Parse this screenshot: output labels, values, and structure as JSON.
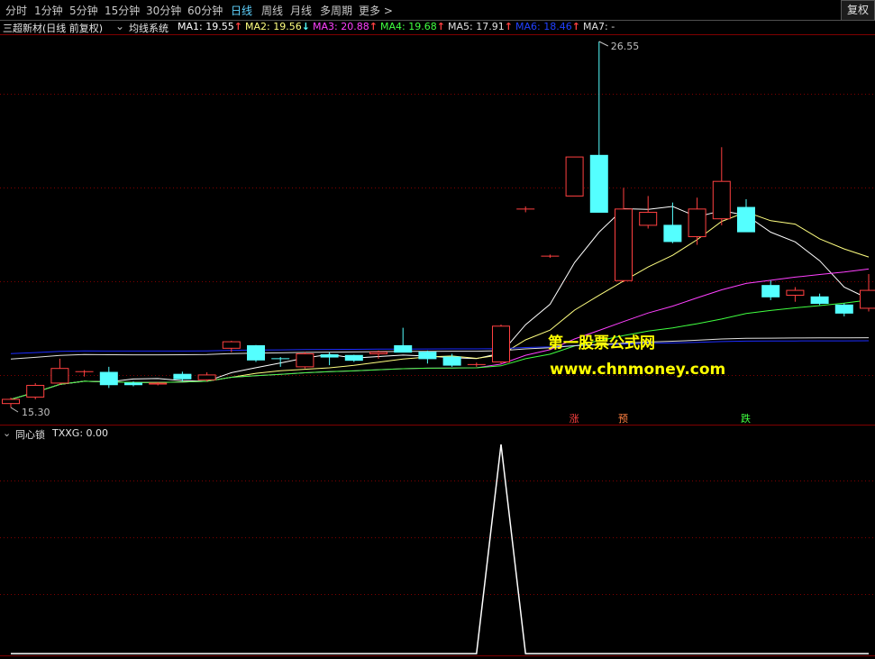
{
  "toolbar": {
    "timeframes": [
      "分时",
      "1分钟",
      "5分钟",
      "15分钟",
      "30分钟",
      "60分钟",
      "日线",
      "周线",
      "月线",
      "多周期",
      "更多 >"
    ],
    "active_index": 6,
    "fq_button": "复权"
  },
  "main_panel": {
    "stock_title": "三超新材(日线 前复权)",
    "indicator_name": "均线系统",
    "ma": [
      {
        "label": "MA1: 19.55",
        "arrow": "↑",
        "color": "#ffffff"
      },
      {
        "label": "MA2: 19.56",
        "arrow": "↓",
        "color": "#ffff80"
      },
      {
        "label": "MA3: 20.88",
        "arrow": "↑",
        "color": "#ff40ff"
      },
      {
        "label": "MA4: 19.68",
        "arrow": "↑",
        "color": "#40ff40"
      },
      {
        "label": "MA5: 17.91",
        "arrow": "↑",
        "color": "#e0e0e0"
      },
      {
        "label": "MA6: 18.46",
        "arrow": "↑",
        "color": "#2040ff"
      },
      {
        "label": "MA7: -",
        "arrow": "",
        "color": "#e0e0e0"
      }
    ],
    "high_label": "26.55",
    "low_label": "15.30",
    "signals": [
      {
        "text": "涨",
        "color": "#ff4040"
      },
      {
        "text": "预",
        "color": "#ff8040"
      },
      {
        "text": "跌",
        "color": "#40ff40"
      }
    ]
  },
  "watermark": {
    "line1": "第一股票公式网",
    "line2": "www.chnmoney.com"
  },
  "sub_panel": {
    "indicator_name": "同心锁",
    "txxg_label": "TXXG: 0.00"
  },
  "colors": {
    "up": "#ff4040",
    "down": "#54ffff",
    "grid": "#800000",
    "watermark": "#ffff00"
  },
  "candles": [
    {
      "o": 15.42,
      "h": 15.6,
      "l": 15.3,
      "c": 15.55
    },
    {
      "o": 15.62,
      "h": 16.05,
      "l": 15.55,
      "c": 15.98
    },
    {
      "o": 16.05,
      "h": 16.8,
      "l": 16.0,
      "c": 16.5
    },
    {
      "o": 16.4,
      "h": 16.45,
      "l": 16.25,
      "c": 16.4
    },
    {
      "o": 16.38,
      "h": 16.55,
      "l": 15.9,
      "c": 16.0
    },
    {
      "o": 16.05,
      "h": 16.1,
      "l": 15.95,
      "c": 16.0
    },
    {
      "o": 16.02,
      "h": 16.08,
      "l": 15.98,
      "c": 16.05
    },
    {
      "o": 16.32,
      "h": 16.4,
      "l": 16.1,
      "c": 16.18
    },
    {
      "o": 16.15,
      "h": 16.38,
      "l": 16.1,
      "c": 16.3
    },
    {
      "o": 17.12,
      "h": 17.35,
      "l": 17.0,
      "c": 17.32
    },
    {
      "o": 17.2,
      "h": 17.22,
      "l": 16.7,
      "c": 16.76
    },
    {
      "o": 16.8,
      "h": 16.85,
      "l": 16.55,
      "c": 16.78
    },
    {
      "o": 16.55,
      "h": 17.0,
      "l": 16.5,
      "c": 16.95
    },
    {
      "o": 16.92,
      "h": 17.0,
      "l": 16.6,
      "c": 16.85
    },
    {
      "o": 16.9,
      "h": 16.92,
      "l": 16.7,
      "c": 16.75
    },
    {
      "o": 16.95,
      "h": 17.05,
      "l": 16.8,
      "c": 17.0
    },
    {
      "o": 17.2,
      "h": 17.75,
      "l": 17.0,
      "c": 17.0
    },
    {
      "o": 17.0,
      "h": 17.05,
      "l": 16.65,
      "c": 16.8
    },
    {
      "o": 16.85,
      "h": 16.95,
      "l": 16.55,
      "c": 16.6
    },
    {
      "o": 16.62,
      "h": 16.68,
      "l": 16.55,
      "c": 16.62
    },
    {
      "o": 16.7,
      "h": 17.85,
      "l": 16.65,
      "c": 17.8
    },
    {
      "o": 21.38,
      "h": 21.48,
      "l": 21.3,
      "c": 21.4
    },
    {
      "o": 19.95,
      "h": 20.0,
      "l": 19.9,
      "c": 19.95
    },
    {
      "o": 21.8,
      "h": 23.0,
      "l": 21.8,
      "c": 23.0
    },
    {
      "o": 23.05,
      "h": 26.55,
      "l": 21.3,
      "c": 21.3
    },
    {
      "o": 19.2,
      "h": 22.05,
      "l": 19.15,
      "c": 21.4
    },
    {
      "o": 20.9,
      "h": 21.8,
      "l": 20.8,
      "c": 21.3
    },
    {
      "o": 20.9,
      "h": 21.6,
      "l": 20.35,
      "c": 20.4
    },
    {
      "o": 20.55,
      "h": 21.75,
      "l": 20.3,
      "c": 21.4
    },
    {
      "o": 21.1,
      "h": 23.3,
      "l": 20.9,
      "c": 22.25
    },
    {
      "o": 21.45,
      "h": 21.7,
      "l": 20.7,
      "c": 20.7
    },
    {
      "o": 19.05,
      "h": 19.2,
      "l": 18.6,
      "c": 18.7
    },
    {
      "o": 18.75,
      "h": 19.0,
      "l": 18.55,
      "c": 18.9
    },
    {
      "o": 18.7,
      "h": 18.8,
      "l": 18.45,
      "c": 18.5
    },
    {
      "o": 18.45,
      "h": 18.5,
      "l": 18.1,
      "c": 18.2
    },
    {
      "o": 18.35,
      "h": 19.4,
      "l": 18.25,
      "c": 18.9
    }
  ],
  "txxg": [
    0,
    0,
    0,
    0,
    0,
    0,
    0,
    0,
    0,
    0,
    0,
    0,
    0,
    0,
    0,
    0,
    0,
    0,
    0,
    0,
    1,
    0,
    0,
    0,
    0,
    0,
    0,
    0,
    0,
    0,
    0,
    0,
    0,
    0,
    0,
    0
  ]
}
